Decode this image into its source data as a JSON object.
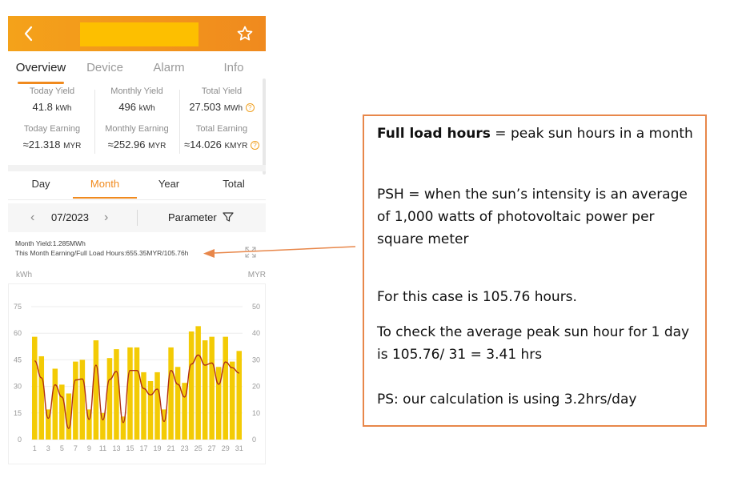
{
  "colors": {
    "accent": "#f08a1e",
    "bar": "#f3cb05",
    "line": "#b03014",
    "annotation_border": "#e8874a"
  },
  "header": {
    "back_icon": "chevron-left-icon",
    "favorite_icon": "star-outline-icon"
  },
  "tabs": [
    {
      "label": "Overview",
      "active": true
    },
    {
      "label": "Device",
      "active": false
    },
    {
      "label": "Alarm",
      "active": false
    },
    {
      "label": "Info",
      "active": false
    }
  ],
  "stats": {
    "today_yield": {
      "label": "Today Yield",
      "value": "41.8",
      "unit": "kWh"
    },
    "monthly_yield": {
      "label": "Monthly Yield",
      "value": "496",
      "unit": "kWh"
    },
    "total_yield": {
      "label": "Total Yield",
      "value": "27.503",
      "unit": "MWh"
    },
    "today_earning": {
      "label": "Today Earning",
      "value": "≈21.318",
      "unit": "MYR"
    },
    "monthly_earning": {
      "label": "Monthly Earning",
      "value": "≈252.96",
      "unit": "MYR"
    },
    "total_earning": {
      "label": "Total Earning",
      "value": "≈14.026",
      "unit": "KMYR"
    }
  },
  "period_tabs": [
    {
      "label": "Day",
      "active": false
    },
    {
      "label": "Month",
      "active": true
    },
    {
      "label": "Year",
      "active": false
    },
    {
      "label": "Total",
      "active": false
    }
  ],
  "date_selector": {
    "value": "07/2023",
    "parameter_label": "Parameter"
  },
  "summary": {
    "month_yield": "Month Yield:1.285MWh",
    "earning_hours": "This Month Earning/Full Load Hours:655.35MYR/105.76h"
  },
  "chart_data": {
    "type": "bar",
    "left_axis_unit": "kWh",
    "right_axis_unit": "MYR",
    "ylim_left": [
      0,
      75
    ],
    "ylim_right": [
      0,
      50
    ],
    "yticks_left": [
      "0",
      "15",
      "30",
      "45",
      "60",
      "75"
    ],
    "yticks_right": [
      "0",
      "10",
      "20",
      "30",
      "40",
      "50"
    ],
    "xtick_labels": [
      "1",
      "3",
      "5",
      "7",
      "9",
      "11",
      "13",
      "15",
      "17",
      "19",
      "21",
      "23",
      "25",
      "27",
      "29",
      "31"
    ],
    "x": [
      1,
      2,
      3,
      4,
      5,
      6,
      7,
      8,
      9,
      10,
      11,
      12,
      13,
      14,
      15,
      16,
      17,
      18,
      19,
      20,
      21,
      22,
      23,
      24,
      25,
      26,
      27,
      28,
      29,
      30,
      31
    ],
    "series": [
      {
        "values": [
          58,
          47,
          17,
          40,
          31,
          26,
          44,
          45,
          17,
          56,
          15,
          46,
          51,
          13,
          52,
          52,
          38,
          33,
          38,
          17,
          52,
          41,
          32,
          61,
          64,
          56,
          58,
          41,
          58,
          44,
          50
        ]
      },
      {
        "values": [
          29.6,
          23.2,
          8.0,
          20.6,
          16.0,
          4.2,
          22.4,
          22.8,
          7.6,
          28.0,
          7.4,
          22.6,
          25.6,
          6.4,
          26.0,
          26.0,
          19.2,
          16.8,
          19.0,
          6.8,
          26.0,
          20.8,
          16.0,
          28.4,
          31.8,
          28.0,
          28.8,
          20.8,
          29.2,
          27.0,
          25.0
        ]
      }
    ]
  },
  "annotation": {
    "line1_bold": "Full load hours",
    "line1_rest": " = peak sun hours in a month",
    "line2": "PSH = when the sun’s intensity is an average of 1,000 watts of photovoltaic power per square meter",
    "line3": "For this case is 105.76 hours.",
    "line4": "To check the average peak sun hour for 1 day is 105.76/ 31 = 3.41 hrs",
    "line5": "PS: our calculation is using 3.2hrs/day"
  }
}
